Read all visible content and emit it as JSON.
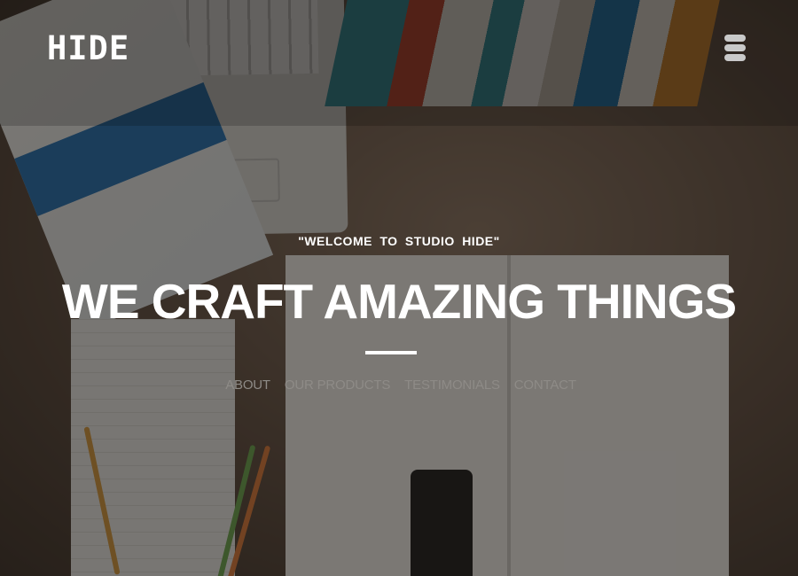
{
  "header": {
    "logo": "HIDE",
    "menu_icon": "hamburger-menu-icon"
  },
  "hero": {
    "tagline": "\"WELCOME TO STUDIO HIDE\"",
    "headline": "WE CRAFT AMAZING THINGS"
  },
  "nav": {
    "items": [
      {
        "label": "ABOUT"
      },
      {
        "label": "OUR PRODUCTS"
      },
      {
        "label": "TESTIMONIALS"
      },
      {
        "label": "CONTACT"
      }
    ]
  },
  "colors": {
    "text": "#ffffff",
    "nav_text": "#8e8b87",
    "menu_icon": "#c9c9c9"
  }
}
